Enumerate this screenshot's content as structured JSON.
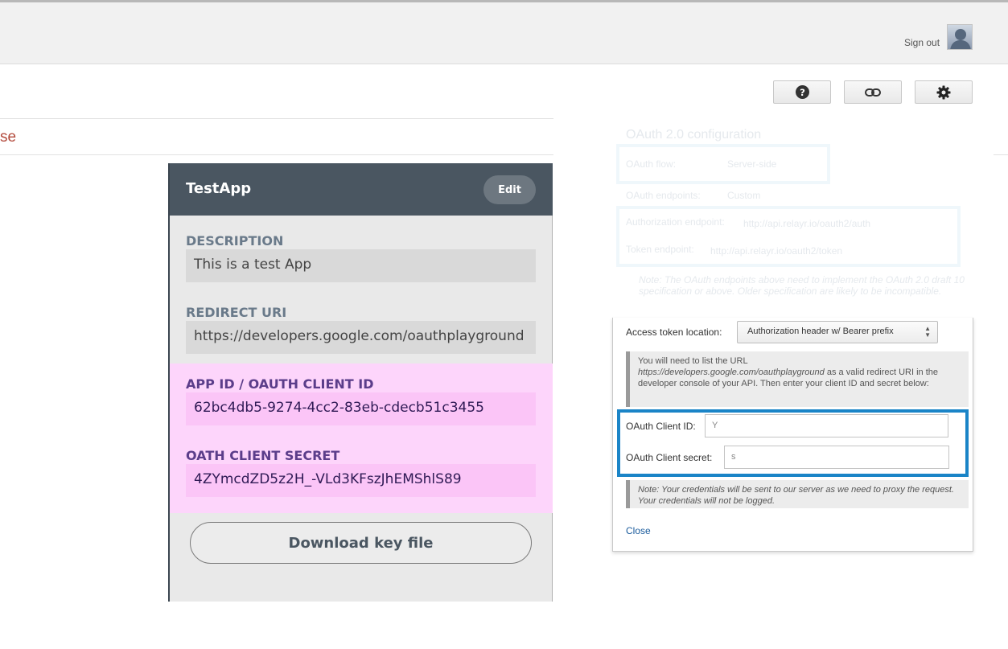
{
  "header": {
    "signout_label": "Sign out",
    "avatar_icon": "user-avatar-icon"
  },
  "toolbar": {
    "help_icon": "question-circle-icon",
    "link_icon": "link-icon",
    "settings_icon": "gear-icon"
  },
  "page": {
    "close_fragment": "se"
  },
  "app_card": {
    "title": "TestApp",
    "edit_label": "Edit",
    "description_label": "DESCRIPTION",
    "description_value": "This is a test App",
    "redirect_label": "REDIRECT URI",
    "redirect_value": "https://developers.google.com/oauthplayground",
    "app_id_label": "APP ID / OAUTH CLIENT ID",
    "app_id_value": "62bc4db5-9274-4cc2-83eb-cdecb51c3455",
    "secret_label": "OATH CLIENT SECRET",
    "secret_value": "4ZYmcdZD5z2H_-VLd3KFszJhEMShlS89",
    "download_label": "Download key file"
  },
  "config_faded": {
    "title": "OAuth 2.0 configuration",
    "flow_label": "OAuth flow:",
    "flow_value": "Server-side",
    "endpoints_label": "OAuth endpoints:",
    "endpoints_value": "Custom",
    "auth_endpoint_label": "Authorization endpoint:",
    "auth_endpoint_value": "http://api.relayr.io/oauth2/auth",
    "token_endpoint_label": "Token endpoint:",
    "token_endpoint_value": "http://api.relayr.io/oauth2/token",
    "note": "Note: The OAuth endpoints above need to implement the OAuth 2.0 draft 10 specification or above. Older specification are likely to be incompatible."
  },
  "panel": {
    "access_token_label": "Access token location:",
    "access_token_value": "Authorization header w/ Bearer prefix",
    "note_pre": "You will need to list the URL",
    "note_url": "https://developers.google.com/oauthplayground",
    "note_post": "as a valid redirect URI in the developer console of your API. Then enter your client ID and secret below:",
    "client_id_label": "OAuth Client ID:",
    "client_id_value": "Y",
    "client_secret_label": "OAuth Client secret:",
    "client_secret_value": "s",
    "credentials_note": "Note: Your credentials will be sent to our server as we need to proxy the request. Your credentials will not be logged.",
    "close_label": "Close"
  }
}
